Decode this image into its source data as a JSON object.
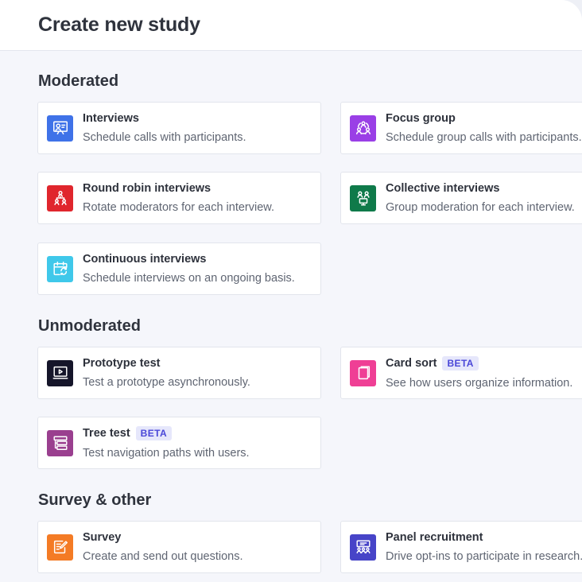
{
  "header": {
    "title": "Create new study"
  },
  "sections": {
    "moderated": "Moderated",
    "unmoderated": "Unmoderated",
    "survey": "Survey & other"
  },
  "cards": {
    "interviews": {
      "title": "Interviews",
      "desc": "Schedule calls with participants.",
      "color": "#3f72e8",
      "icon": "presentation-user-icon"
    },
    "focus_group": {
      "title": "Focus group",
      "desc": "Schedule group calls with participants.",
      "color": "#9a3fe6",
      "icon": "group-circle-icon"
    },
    "round_robin": {
      "title": "Round robin interviews",
      "desc": "Rotate moderators for each interview.",
      "color": "#e0262d",
      "icon": "hierarchy-users-icon"
    },
    "collective": {
      "title": "Collective interviews",
      "desc": "Group moderation for each interview.",
      "color": "#0f7a4a",
      "icon": "users-monitor-icon"
    },
    "continuous": {
      "title": "Continuous interviews",
      "desc": "Schedule interviews on an ongoing basis.",
      "color": "#3fc8ea",
      "icon": "calendar-refresh-icon"
    },
    "prototype": {
      "title": "Prototype test",
      "desc": "Test a prototype asynchronously.",
      "color": "#15152a",
      "icon": "play-screen-icon"
    },
    "card_sort": {
      "title": "Card sort",
      "badge": "BETA",
      "desc": "See how users organize information.",
      "color": "#ef3f95",
      "icon": "cards-icon"
    },
    "tree_test": {
      "title": "Tree test",
      "badge": "BETA",
      "desc": "Test navigation paths with users.",
      "color": "#9a3f8f",
      "icon": "tree-list-icon"
    },
    "survey": {
      "title": "Survey",
      "desc": "Create and send out questions.",
      "color": "#f47b25",
      "icon": "edit-form-icon"
    },
    "panel": {
      "title": "Panel recruitment",
      "desc": "Drive opt-ins to participate in research.",
      "color": "#4744c8",
      "icon": "group-board-icon"
    }
  }
}
